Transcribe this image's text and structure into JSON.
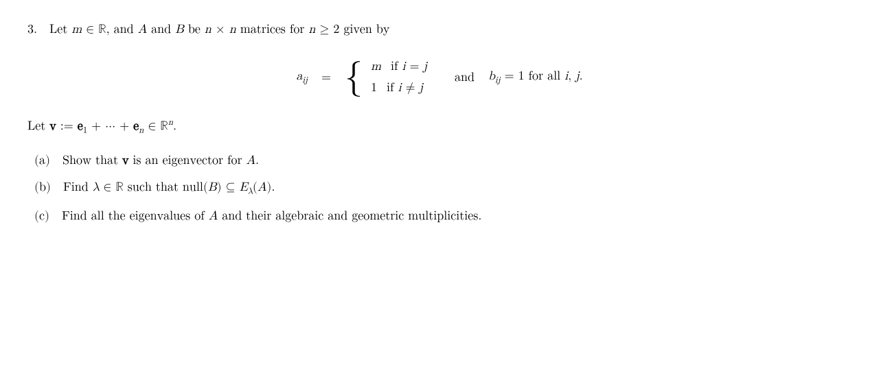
{
  "problem": {
    "number": "3.",
    "header": "Let m ∈ ℝ, and A and B be n × n matrices for n ≥ 2 given by",
    "matrix_a_label": "a",
    "matrix_a_subscript": "ij",
    "case1_value": "m",
    "case1_condition": "if i = j",
    "case2_value": "1",
    "case2_condition": "if i ≠ j",
    "and_label": "and",
    "matrix_b_def": "b",
    "matrix_b_sub": "ij",
    "matrix_b_rest": "= 1  for all  i, j.",
    "let_v": "Let v := e₁ + ··· + eₙ ∈ ℝⁿ.",
    "parts": [
      {
        "label": "(a)",
        "text": "Show that v is an eigenvector for A."
      },
      {
        "label": "(b)",
        "text": "Find λ ∈ ℝ such that null(B) ⊆ E_λ(A)."
      },
      {
        "label": "(c)",
        "text": "Find all the eigenvalues of A and their algebraic and geometric multiplicities."
      }
    ]
  }
}
